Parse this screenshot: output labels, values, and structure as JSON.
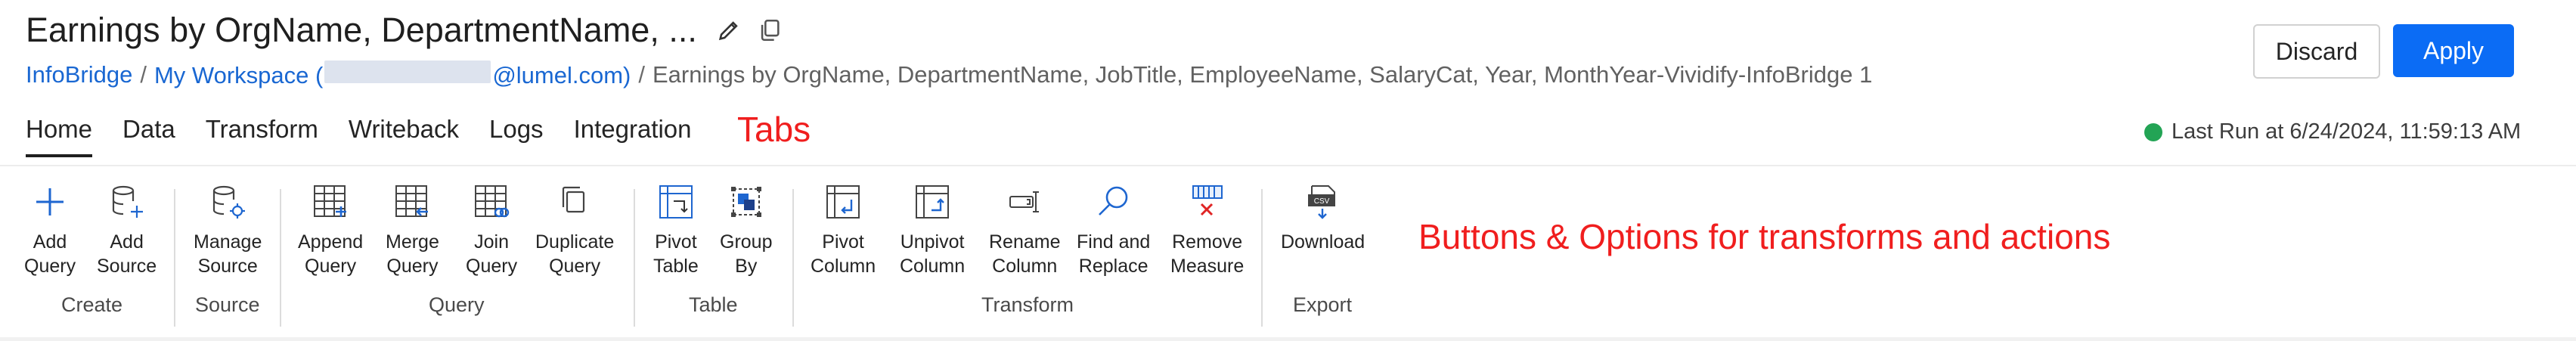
{
  "header": {
    "title": "Earnings by OrgName, DepartmentName, ...",
    "breadcrumb": {
      "root": "InfoBridge",
      "workspace_prefix": "My Workspace (",
      "workspace_suffix": "@lumel.com)",
      "separator": "/",
      "current": "Earnings by OrgName, DepartmentName, JobTitle, EmployeeName, SalaryCat, Year, MonthYear-Vividify-InfoBridge 1"
    },
    "discard_label": "Discard",
    "apply_label": "Apply"
  },
  "tabs": [
    "Home",
    "Data",
    "Transform",
    "Writeback",
    "Logs",
    "Integration"
  ],
  "active_tab": "Home",
  "annotations": {
    "tabs": "Tabs",
    "buttons": "Buttons & Options for transforms and actions"
  },
  "status": {
    "last_run": "Last Run at 6/24/2024, 11:59:13 AM",
    "color": "#23a455"
  },
  "ribbon": {
    "buttons": [
      {
        "label": "Add\nQuery",
        "icon": "plus-icon"
      },
      {
        "label": "Add\nSource",
        "icon": "add-source-icon"
      },
      {
        "label": "Manage\nSource",
        "icon": "manage-source-icon"
      },
      {
        "label": "Append\nQuery",
        "icon": "append-query-icon"
      },
      {
        "label": "Merge\nQuery",
        "icon": "merge-query-icon"
      },
      {
        "label": "Join\nQuery",
        "icon": "join-query-icon"
      },
      {
        "label": "Duplicate\nQuery",
        "icon": "duplicate-query-icon"
      },
      {
        "label": "Pivot\nTable",
        "icon": "pivot-table-icon"
      },
      {
        "label": "Group\nBy",
        "icon": "group-by-icon"
      },
      {
        "label": "Pivot\nColumn",
        "icon": "pivot-column-icon"
      },
      {
        "label": "Unpivot\nColumn",
        "icon": "unpivot-column-icon"
      },
      {
        "label": "Rename\nColumn",
        "icon": "rename-column-icon"
      },
      {
        "label": "Find and\nReplace",
        "icon": "search-icon"
      },
      {
        "label": "Remove\nMeasure",
        "icon": "remove-measure-icon"
      },
      {
        "label": "Download",
        "icon": "download-csv-icon"
      }
    ],
    "groups": [
      "Create",
      "Source",
      "Query",
      "Table",
      "Transform",
      "Export"
    ],
    "csv_text": "CSV"
  },
  "colors": {
    "accent": "#0b6cf5",
    "link": "#1967d2",
    "annotation": "#f01e1e"
  }
}
